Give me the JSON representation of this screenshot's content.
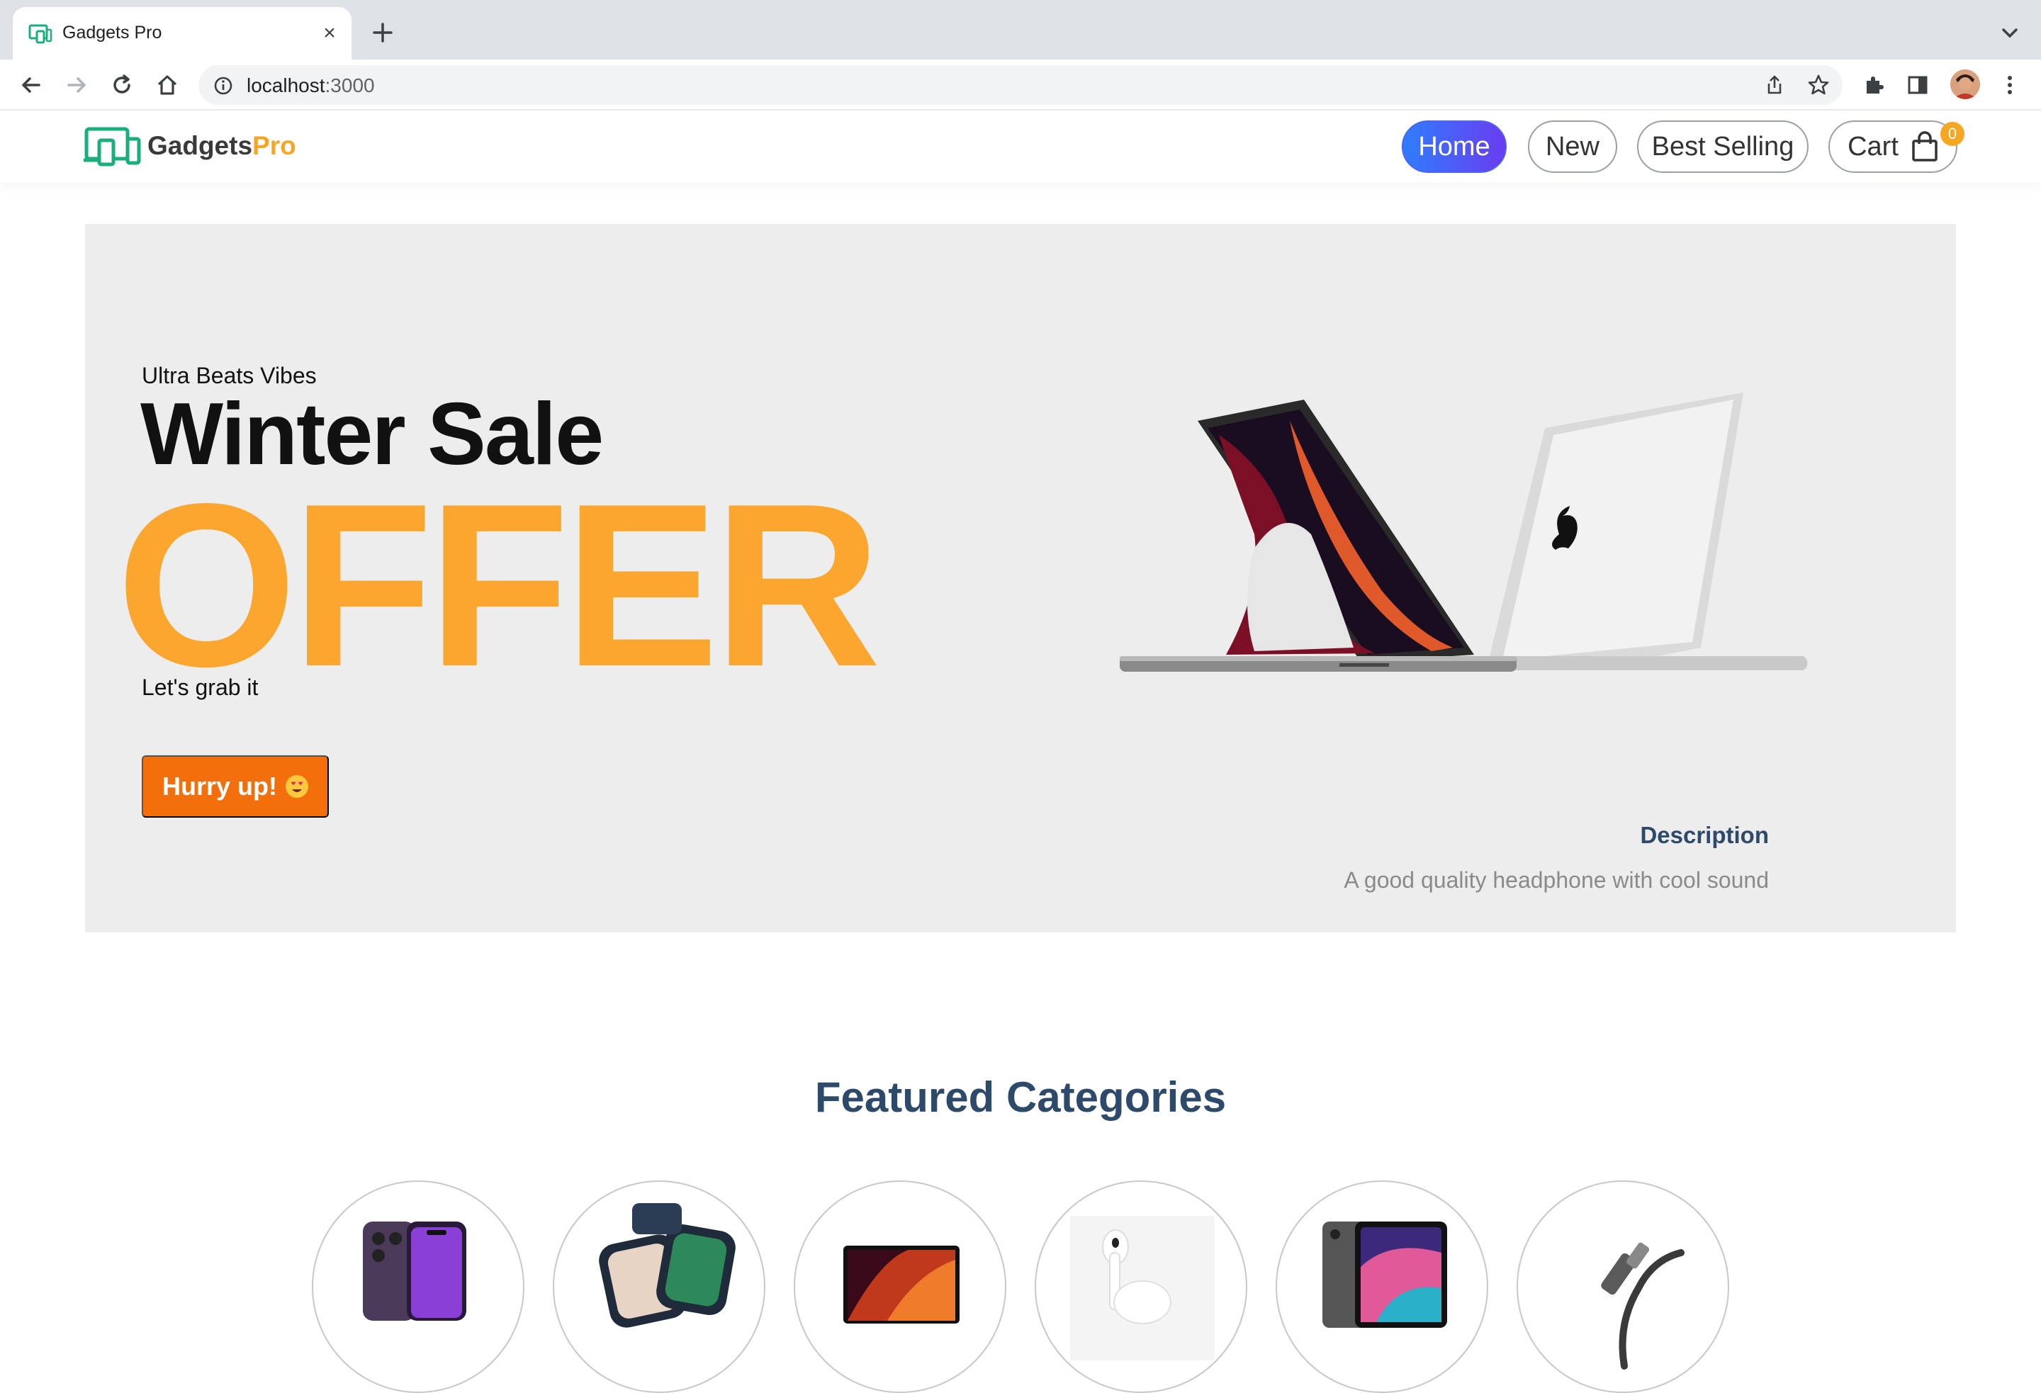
{
  "browser": {
    "tab_title": "Gadgets Pro",
    "url_host": "localhost",
    "url_port": ":3000"
  },
  "site": {
    "logo_text": "Gadgets",
    "logo_accent": "Pro",
    "nav": {
      "home": "Home",
      "new": "New",
      "best_selling": "Best Selling",
      "cart": "Cart",
      "cart_count": "0"
    }
  },
  "hero": {
    "eyebrow": "Ultra Beats Vibes",
    "title": "Winter Sale",
    "offer": "OFFER",
    "subtext": "Let's grab it",
    "cta": "Hurry up!",
    "description_label": "Description",
    "description_text": "A good quality headphone with cool sound"
  },
  "featured": {
    "title": "Featured Categories",
    "categories": [
      {
        "icon": "iphone-icon"
      },
      {
        "icon": "smartwatch-icon"
      },
      {
        "icon": "macbook-icon"
      },
      {
        "icon": "airpods-icon"
      },
      {
        "icon": "ipad-icon"
      },
      {
        "icon": "cable-icon"
      }
    ]
  },
  "colors": {
    "accent_orange": "#fba62f",
    "cta_orange": "#f26f0c",
    "nav_active_start": "#2f7dfb",
    "nav_active_end": "#6a3cf0",
    "heading_navy": "#2d4a6b",
    "logo_green": "#1aae7a"
  }
}
